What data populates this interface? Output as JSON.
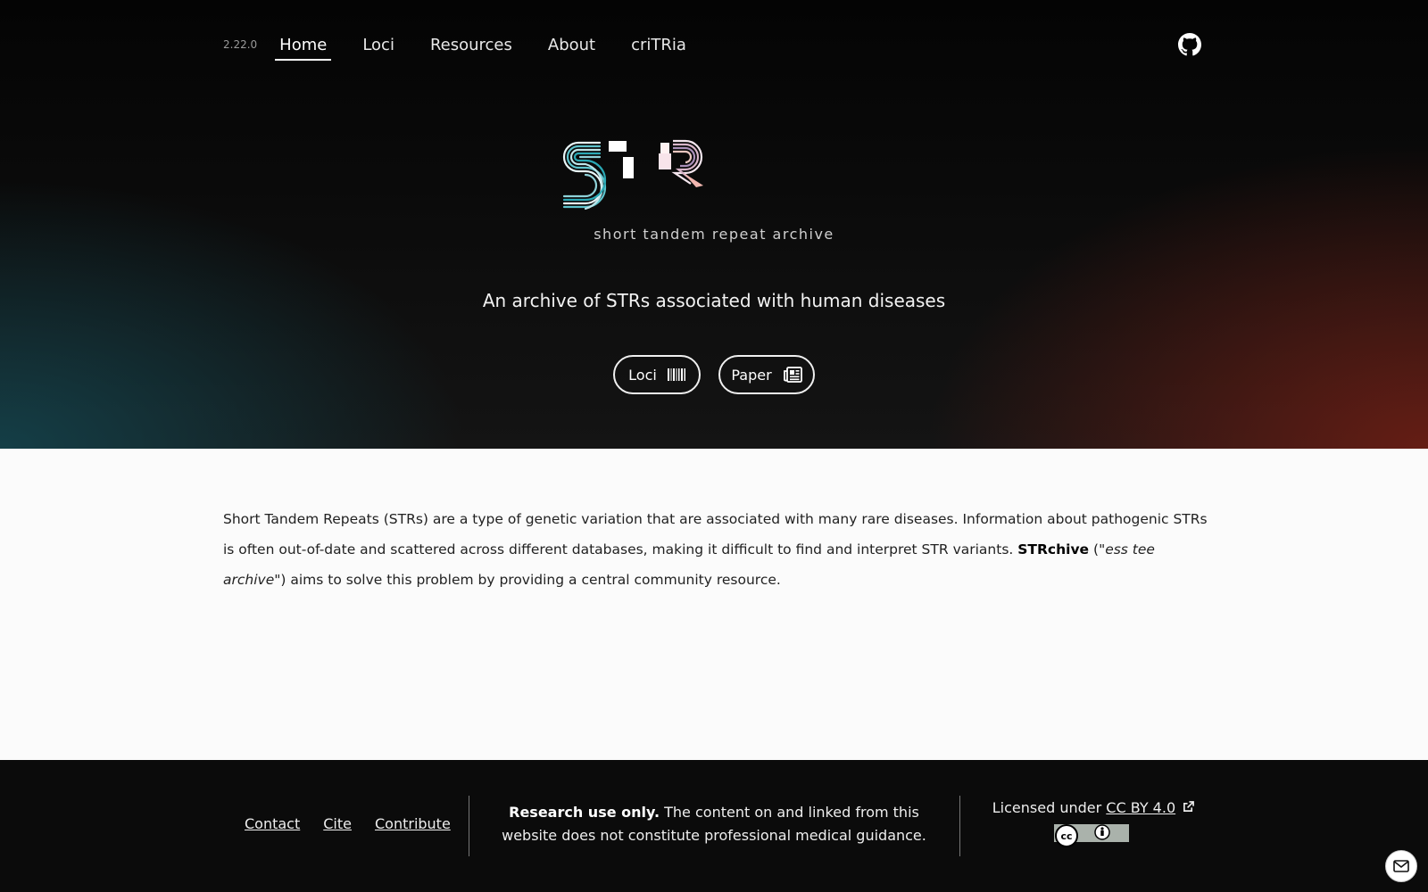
{
  "nav": {
    "version": "2.22.0",
    "items": [
      {
        "label": "Home"
      },
      {
        "label": "Loci"
      },
      {
        "label": "Resources"
      },
      {
        "label": "About"
      },
      {
        "label": "criTRia"
      }
    ]
  },
  "hero": {
    "tagline": "short tandem repeat archive",
    "subtitle": "An archive of STRs associated with human diseases",
    "buttons": [
      {
        "label": "Loci",
        "icon": "barcode-icon"
      },
      {
        "label": "Paper",
        "icon": "newspaper-icon"
      }
    ]
  },
  "intro": {
    "part1": "Short Tandem Repeats (STRs) are a type of genetic variation that are associated with many rare diseases. Information about pathogenic STRs is often out-of-date and scattered across different databases, making it difficult to find and interpret STR variants. ",
    "brand": "STRchive",
    "open_paren": " (",
    "pronunciation": "\"ess tee archive\"",
    "part2": ") aims to solve this problem by providing a central community resource."
  },
  "footer": {
    "links": [
      "Contact",
      "Cite",
      "Contribute"
    ],
    "disclaimer_bold": "Research use only.",
    "disclaimer_text": " The content on and linked from this website does not constitute professional medical guidance.",
    "license_prefix": "Licensed under ",
    "license_link": "CC BY 4.0"
  },
  "colors": {
    "hero_teal": "#144650",
    "hero_red": "#6e1e14",
    "footer_bg": "#0b0b0b"
  }
}
